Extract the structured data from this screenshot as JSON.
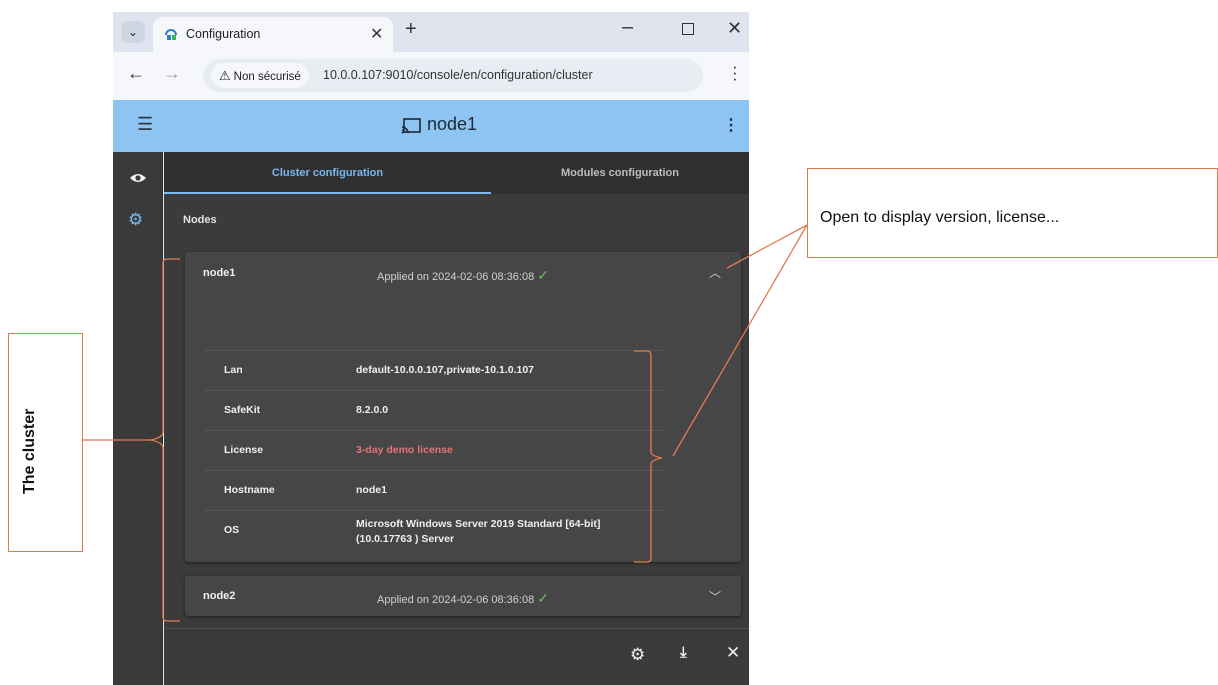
{
  "browser": {
    "tab_title": "Configuration",
    "tab_close": "✕",
    "new_tab": "+",
    "security_badge": "Non sécurisé",
    "url": "10.0.0.107:9010/console/en/configuration/cluster"
  },
  "app": {
    "title": "node1",
    "tabs": [
      {
        "label": "Cluster configuration",
        "active": true
      },
      {
        "label": "Modules configuration",
        "active": false
      }
    ],
    "section_title": "Nodes",
    "nodes": [
      {
        "name": "node1",
        "status": "Applied on 2024-02-06 08:36:08",
        "expanded": true,
        "properties": [
          {
            "key": "Lan",
            "value": "default-10.0.0.107,private-10.1.0.107"
          },
          {
            "key": "SafeKit",
            "value": "8.2.0.0"
          },
          {
            "key": "License",
            "value": "3-day demo license"
          },
          {
            "key": "Hostname",
            "value": "node1"
          },
          {
            "key": "OS",
            "value": "Microsoft Windows Server 2019 Standard [64-bit] (10.0.17763 ) Server"
          }
        ]
      },
      {
        "name": "node2",
        "status": "Applied on 2024-02-06 08:36:08",
        "expanded": false
      }
    ]
  },
  "annotations": {
    "right": "Open to display version, license...",
    "left": "The cluster"
  },
  "colors": {
    "header": "#8dc4f2",
    "accent": "#7ab8ef",
    "license_warning": "#e57373",
    "annotation": "#e07a4f",
    "success": "#6ac15a"
  },
  "icons": [
    "chevron-down-icon",
    "favicon-icon",
    "close-icon",
    "plus-icon",
    "minimize-icon",
    "maximize-icon",
    "back-icon",
    "forward-icon",
    "warning-icon",
    "star-icon",
    "kebab-icon",
    "hamburger-icon",
    "cast-icon",
    "eye-icon",
    "gear-icon",
    "check-icon",
    "chevron-up-icon",
    "download-icon"
  ]
}
